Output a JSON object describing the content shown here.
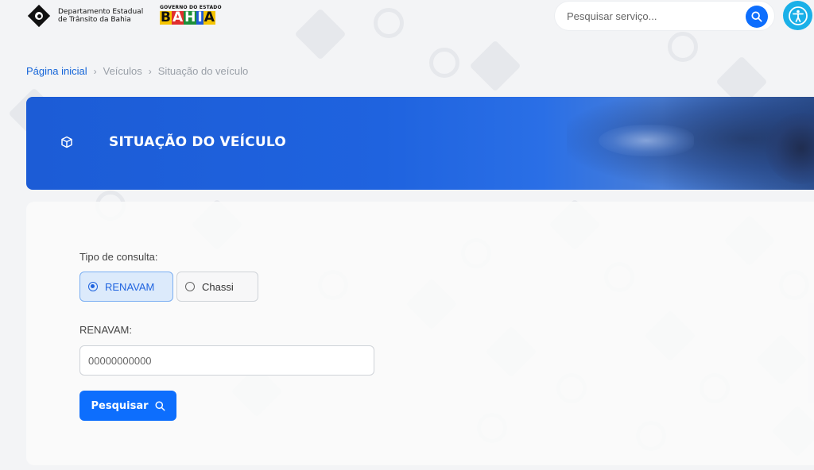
{
  "header": {
    "detran_line1": "Departamento Estadual",
    "detran_line2": "de Trânsito da Bahia",
    "gov_small": "GOVERNO DO ESTADO",
    "gov_letters": [
      "B",
      "A",
      "H",
      "I",
      "A"
    ],
    "search_placeholder": "Pesquisar serviço...",
    "accent": "#0d6efd",
    "accessibility_color": "#1ab0e8",
    "icons": [
      "search-icon",
      "accessibility-icon"
    ]
  },
  "breadcrumb": {
    "home": "Página inicial",
    "separator": "›",
    "section": "Veículos",
    "current": "Situação do veículo"
  },
  "banner": {
    "title": "SITUAÇÃO DO VEÍCULO",
    "icon": "cube-icon",
    "color": "#1f63df"
  },
  "form": {
    "query_type_label": "Tipo de consulta:",
    "options": [
      {
        "label": "RENAVAM",
        "selected": true
      },
      {
        "label": "Chassi",
        "selected": false
      }
    ],
    "field_label": "RENAVAM:",
    "field_placeholder": "00000000000",
    "field_value": "",
    "submit_label": "Pesquisar"
  }
}
